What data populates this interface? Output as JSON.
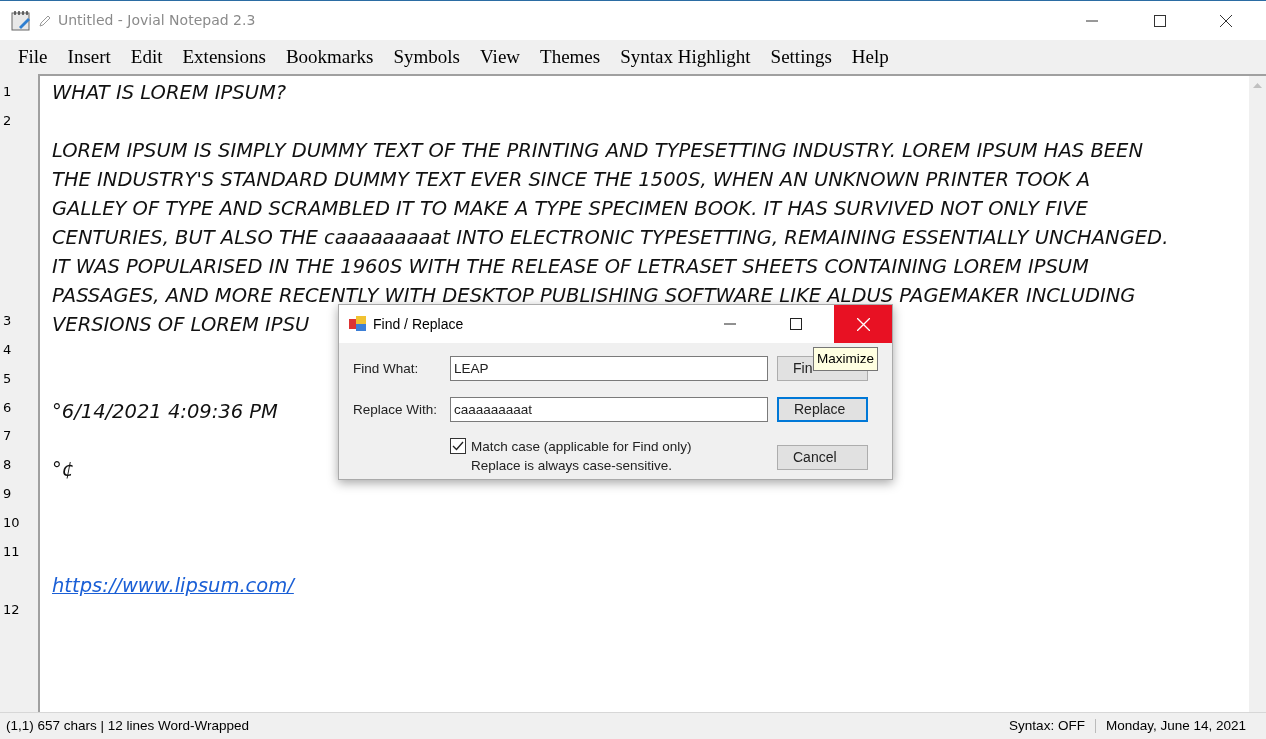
{
  "window": {
    "title": "Untitled - Jovial Notepad 2.3"
  },
  "menu": [
    "File",
    "Insert",
    "Edit",
    "Extensions",
    "Bookmarks",
    "Symbols",
    "View",
    "Themes",
    "Syntax Highlight",
    "Settings",
    "Help"
  ],
  "line_numbers": [
    "1",
    "2",
    "3",
    "4",
    "5",
    "6",
    "7",
    "8",
    "9",
    "10",
    "11",
    "12"
  ],
  "editor_lines": [
    {
      "kind": "text",
      "text": "WHAT IS LOREM IPSUM?"
    },
    {
      "kind": "blank"
    },
    {
      "kind": "text",
      "text": "LOREM IPSUM IS SIMPLY DUMMY TEXT OF THE PRINTING AND TYPESETTING INDUSTRY. LOREM IPSUM HAS BEEN"
    },
    {
      "kind": "text",
      "text": "THE INDUSTRY'S STANDARD DUMMY TEXT EVER SINCE THE 1500S, WHEN AN UNKNOWN PRINTER TOOK A"
    },
    {
      "kind": "text",
      "text": "GALLEY OF TYPE AND SCRAMBLED IT TO MAKE A TYPE SPECIMEN BOOK. IT HAS SURVIVED NOT ONLY FIVE"
    },
    {
      "kind": "text",
      "text": "CENTURIES, BUT ALSO THE caaaaaaaaat INTO ELECTRONIC TYPESETTING, REMAINING ESSENTIALLY UNCHANGED."
    },
    {
      "kind": "text",
      "text": "IT WAS POPULARISED IN THE 1960S WITH THE RELEASE OF LETRASET SHEETS CONTAINING LOREM IPSUM"
    },
    {
      "kind": "text",
      "text": "PASSAGES, AND MORE RECENTLY WITH DESKTOP PUBLISHING SOFTWARE LIKE ALDUS PAGEMAKER INCLUDING"
    },
    {
      "kind": "text",
      "text": "VERSIONS OF LOREM IPSU"
    },
    {
      "kind": "blank"
    },
    {
      "kind": "blank"
    },
    {
      "kind": "text",
      "text": "°6/14/2021 4:09:36 PM"
    },
    {
      "kind": "blank"
    },
    {
      "kind": "text",
      "text": "°¢"
    },
    {
      "kind": "blank"
    },
    {
      "kind": "blank"
    },
    {
      "kind": "blank"
    },
    {
      "kind": "link",
      "text": "https://www.lipsum.com/"
    }
  ],
  "dialog": {
    "title": "Find / Replace",
    "find_label": "Find What:",
    "find_value": "LEAP",
    "replace_label": "Replace With:",
    "replace_value": "caaaaaaaaat",
    "match_case": {
      "label": "Match case (applicable for Find only)",
      "checked": true
    },
    "note": "Replace is always case-sensitive.",
    "buttons": [
      {
        "label": "Fin",
        "focused": false
      },
      {
        "label": "Replace",
        "focused": true
      },
      {
        "label": "Cancel",
        "focused": false
      }
    ],
    "tooltip": "Maximize"
  },
  "status_bar": {
    "left": "(1,1)  657 chars | 12 lines  Word-Wrapped",
    "syntax": "Syntax: OFF",
    "date": "Monday, June 14, 2021"
  }
}
